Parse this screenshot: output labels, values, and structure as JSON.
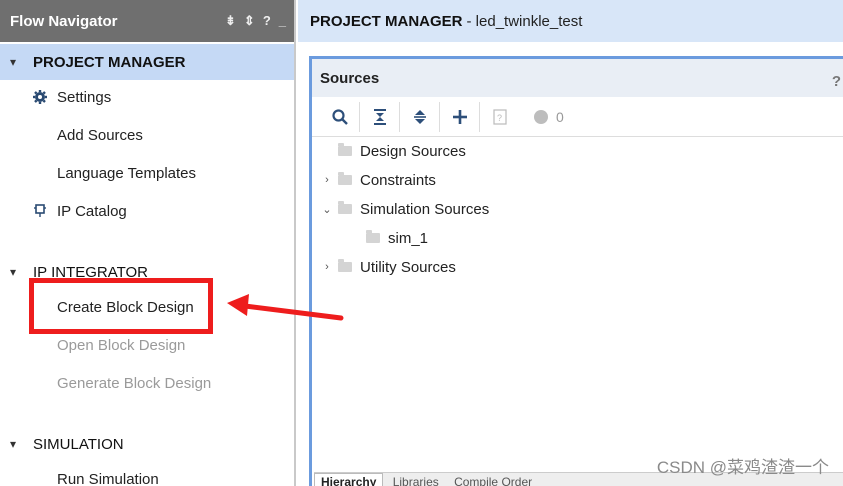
{
  "flow_navigator": {
    "title": "Flow Navigator",
    "header_icons": [
      "collapse-all-icon",
      "sort-icon",
      "help-icon",
      "minimize-icon"
    ],
    "header_help": "?",
    "sections": {
      "project_manager": {
        "label": "PROJECT MANAGER",
        "items": {
          "settings": "Settings",
          "add_sources": "Add Sources",
          "language_templates": "Language Templates",
          "ip_catalog": "IP Catalog"
        }
      },
      "ip_integrator": {
        "label": "IP INTEGRATOR",
        "items": {
          "create_block_design": "Create Block Design",
          "open_block_design": "Open Block Design",
          "generate_block_design": "Generate Block Design"
        }
      },
      "simulation": {
        "label": "SIMULATION",
        "items": {
          "run_simulation": "Run Simulation"
        }
      }
    }
  },
  "project_manager_header": {
    "title": "PROJECT MANAGER",
    "project_name": "- led_twinkle_test"
  },
  "sources": {
    "title": "Sources",
    "help": "?",
    "toolbar": {
      "buttons": [
        "search-icon",
        "collapse-all-icon",
        "expand-all-icon",
        "add-icon",
        "properties-icon"
      ],
      "status_count": "0"
    },
    "tree": {
      "design_sources": "Design Sources",
      "constraints": "Constraints",
      "simulation_sources": "Simulation Sources",
      "sim_1": "sim_1",
      "utility_sources": "Utility Sources"
    },
    "bottom_tabs": [
      "Hierarchy",
      "Libraries",
      "Compile Order"
    ]
  },
  "annotation": {
    "highlight_color": "#ee1d1d"
  },
  "watermark": "CSDN @菜鸡渣渣一个"
}
